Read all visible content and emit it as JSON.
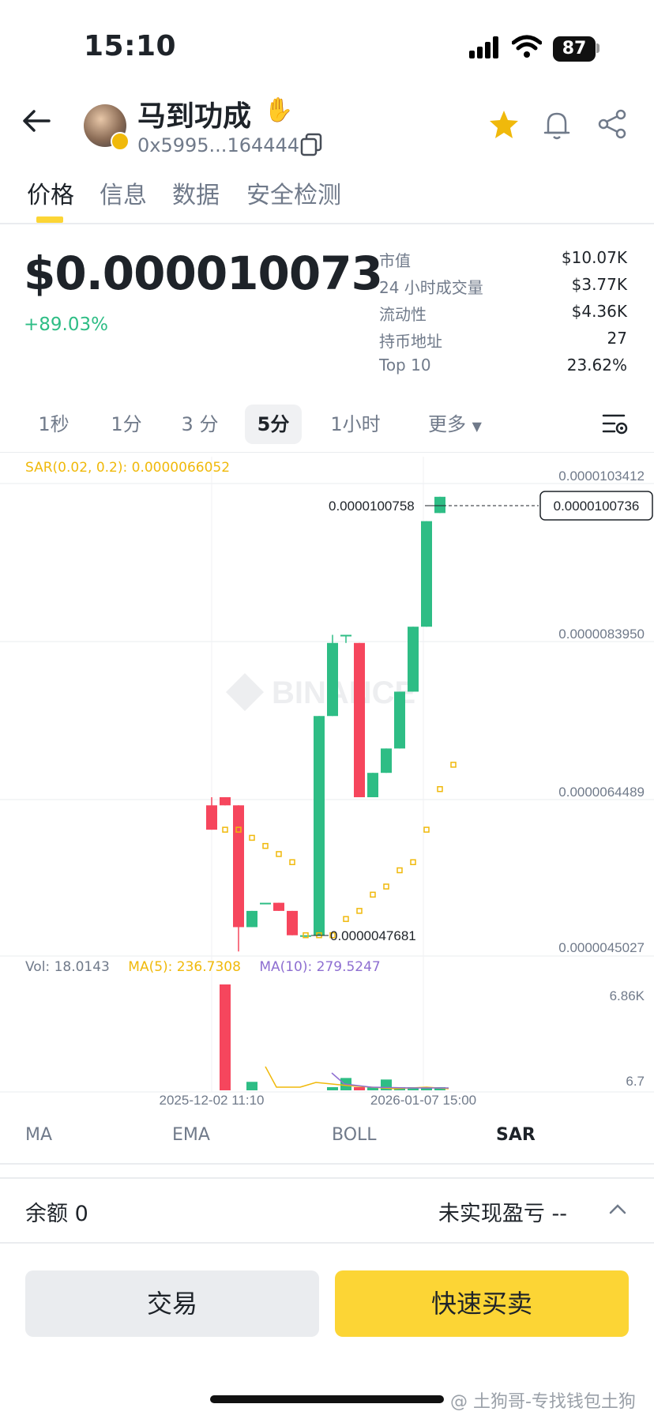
{
  "status_bar": {
    "time": "15:10",
    "battery": "87"
  },
  "header": {
    "coin_name": "马到功成",
    "address": "0x5995...164444"
  },
  "tabs": [
    "价格",
    "信息",
    "数据",
    "安全检测"
  ],
  "price": {
    "value": "$0.000010073",
    "change": "+89.03%",
    "stats": [
      {
        "label": "市值",
        "value": "$10.07K"
      },
      {
        "label": "24 小时成交量",
        "value": "$3.77K"
      },
      {
        "label": "流动性",
        "value": "$4.36K"
      },
      {
        "label": "持币地址",
        "value": "27"
      },
      {
        "label": "Top 10",
        "value": "23.62%"
      }
    ]
  },
  "intervals": [
    "1秒",
    "1分",
    "3 分",
    "5分",
    "1小时",
    "更多"
  ],
  "intervals_active": "5分",
  "chart": {
    "sar_label": "SAR(0.02, 0.2): 0.0000066052",
    "watermark": "BINANCE",
    "y_ticks": [
      "0.0000103412",
      "0.0000083950",
      "0.0000064489",
      "0.0000045027"
    ],
    "current_price": "0.0000100736",
    "high_label": "0.0000100758",
    "low_label": "0.0000047681",
    "vol": "Vol: 18.0143",
    "ma5": "MA(5): 236.7308",
    "ma10": "MA(10): 279.5247",
    "vol_ticks": [
      "6.86K",
      "6.7"
    ],
    "x_ticks": [
      "2025-12-02 11:10",
      "2026-01-07 15:00"
    ]
  },
  "chart_data": {
    "type": "candlestick",
    "y_range": [
      4.5027e-06,
      1.03412e-05
    ],
    "candles": [
      {
        "o": 6.3e-06,
        "h": 6.4e-06,
        "l": 6e-06,
        "c": 6e-06
      },
      {
        "o": 6.4e-06,
        "h": 6.4e-06,
        "l": 6.3e-06,
        "c": 6.3e-06
      },
      {
        "o": 6.3e-06,
        "h": 6.3e-06,
        "l": 4.5e-06,
        "c": 4.8e-06
      },
      {
        "o": 4.8e-06,
        "h": 5e-06,
        "l": 4.8e-06,
        "c": 5e-06
      },
      {
        "o": 5.1e-06,
        "h": 5.1e-06,
        "l": 5.1e-06,
        "c": 5.1e-06
      },
      {
        "o": 5.1e-06,
        "h": 5.1e-06,
        "l": 5e-06,
        "c": 5e-06
      },
      {
        "o": 5e-06,
        "h": 5e-06,
        "l": 4.7e-06,
        "c": 4.7e-06
      },
      {
        "o": 4.7e-06,
        "h": 4.7e-06,
        "l": 4.7e-06,
        "c": 4.7e-06
      },
      {
        "o": 4.7e-06,
        "h": 7.4e-06,
        "l": 4.7e-06,
        "c": 7.4e-06
      },
      {
        "o": 7.4e-06,
        "h": 8.4e-06,
        "l": 7.4e-06,
        "c": 8.3e-06
      },
      {
        "o": 8.4e-06,
        "h": 8.4e-06,
        "l": 8.3e-06,
        "c": 8.4e-06
      },
      {
        "o": 8.3e-06,
        "h": 8.3e-06,
        "l": 6.4e-06,
        "c": 6.4e-06
      },
      {
        "o": 6.4e-06,
        "h": 6.7e-06,
        "l": 6.4e-06,
        "c": 6.7e-06
      },
      {
        "o": 6.7e-06,
        "h": 7e-06,
        "l": 6.7e-06,
        "c": 7e-06
      },
      {
        "o": 7e-06,
        "h": 7.7e-06,
        "l": 7e-06,
        "c": 7.7e-06
      },
      {
        "o": 7.7e-06,
        "h": 8.5e-06,
        "l": 7.7e-06,
        "c": 8.5e-06
      },
      {
        "o": 8.5e-06,
        "h": 9.8e-06,
        "l": 8.5e-06,
        "c": 9.8e-06
      },
      {
        "o": 9.9e-06,
        "h": 1.01e-05,
        "l": 9.9e-06,
        "c": 1.01e-05
      }
    ],
    "sar": [
      null,
      6e-06,
      6e-06,
      5.9e-06,
      5.8e-06,
      5.7e-06,
      5.6e-06,
      4.7e-06,
      4.7e-06,
      4.7e-06,
      4.9e-06,
      5e-06,
      5.2e-06,
      5.3e-06,
      5.5e-06,
      5.6e-06,
      6e-06,
      6.5e-06,
      6.8e-06
    ],
    "volume": [
      0,
      6860,
      0,
      550,
      0,
      0,
      0,
      0,
      0,
      0,
      800,
      0,
      0,
      700,
      0,
      0,
      0,
      0,
      0
    ],
    "volume_color": [
      "up",
      "up",
      "down",
      "up",
      "up",
      "down",
      "down",
      "up",
      "up",
      "up",
      "down",
      "up",
      "up",
      "up",
      "up",
      "up",
      "up"
    ]
  },
  "indicators": [
    "MA",
    "EMA",
    "BOLL",
    "SAR"
  ],
  "indicators_active": "SAR",
  "balance": {
    "label": "余额 0",
    "pnl": "未实现盈亏 --"
  },
  "buttons": {
    "trade": "交易",
    "quick": "快速买卖"
  },
  "watermark_text": "@ 土狗哥-专找钱包土狗",
  "colors": {
    "up": "#2ebd85",
    "down": "#f6465d",
    "accent": "#fcd535",
    "sar": "#f0b90b",
    "ma10": "#8e6fd1"
  }
}
